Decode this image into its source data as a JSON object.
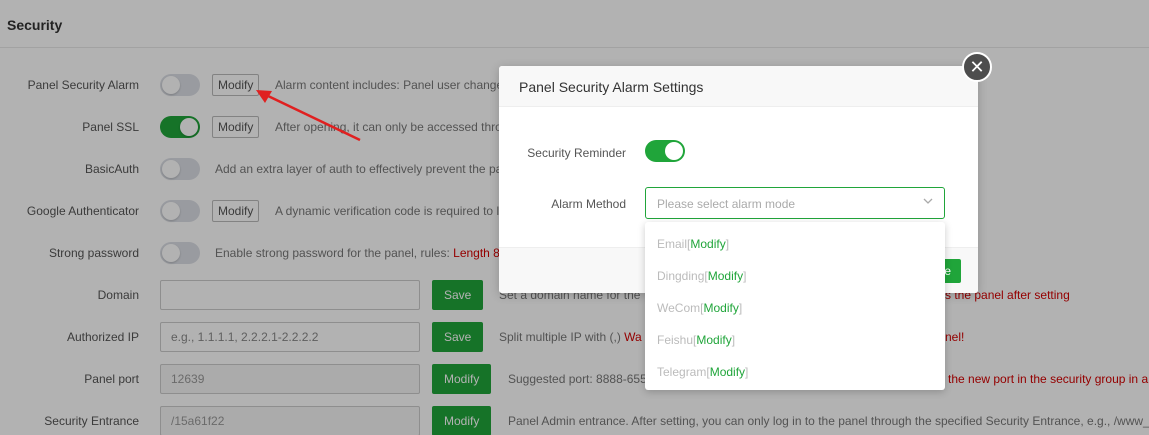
{
  "header": {
    "title": "Security"
  },
  "settings": {
    "panel_security_alarm": {
      "label": "Panel Security Alarm",
      "button": "Modify",
      "desc": "Alarm content includes: Panel user change"
    },
    "panel_ssl": {
      "label": "Panel SSL",
      "button": "Modify",
      "desc": "After opening, it can only be accessed thro"
    },
    "basic_auth": {
      "label": "BasicAuth",
      "desc": "Add an extra layer of auth to effectively prevent the pa"
    },
    "google_auth": {
      "label": "Google Authenticator",
      "button": "Modify",
      "desc": "A dynamic verification code is required to l"
    },
    "strong_password": {
      "label": "Strong password",
      "desc": "Enable strong password for the panel, rules: ",
      "desc_red": "Length 8,"
    },
    "domain": {
      "label": "Domain",
      "value": "",
      "button": "Save",
      "desc": "Set a domain name for the",
      "desc_red": "s the panel after setting"
    },
    "authorized_ip": {
      "label": "Authorized IP",
      "placeholder": "e.g., 1.1.1.1, 2.2.2.1-2.2.2.2",
      "button": "Save",
      "desc": "Split multiple IP with (,) ",
      "desc_red": "Wa",
      "desc_red2": "nel!"
    },
    "panel_port": {
      "label": "Panel port",
      "value": "12639",
      "button": "Modify",
      "desc": "Suggested port: 8888-655",
      "desc_red": "the new port in the security group in a"
    },
    "security_entrance": {
      "label": "Security Entrance",
      "value": "/15a61f22",
      "button": "Modify",
      "desc": "Panel Admin entrance. After setting, you can only log in to the panel through the specified Security Entrance, e.g., /www_b"
    }
  },
  "modal": {
    "title": "Panel Security Alarm Settings",
    "close_icon": "close-icon",
    "security_reminder_label": "Security Reminder",
    "security_reminder_on": true,
    "alarm_method_label": "Alarm Method",
    "alarm_method_placeholder": "Please select alarm mode",
    "confirm_label": "e"
  },
  "dropdown": {
    "modify_label": "Modify",
    "items": [
      {
        "name": "Email"
      },
      {
        "name": "Dingding"
      },
      {
        "name": "WeCom"
      },
      {
        "name": "Feishu"
      },
      {
        "name": "Telegram"
      }
    ]
  },
  "colors": {
    "accent": "#20a53a",
    "warning": "#d50000",
    "arrow": "#e02020"
  }
}
